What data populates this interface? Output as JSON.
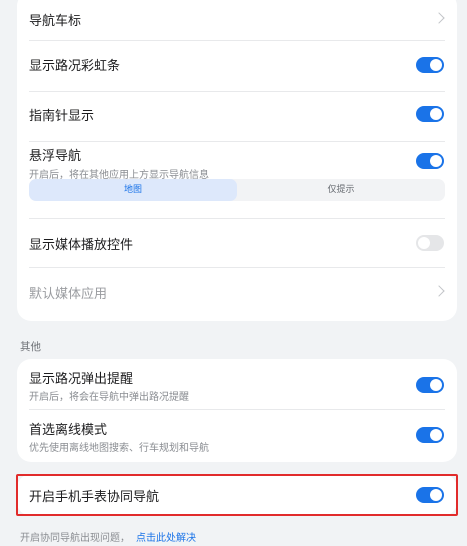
{
  "card1": {
    "items": [
      {
        "title": "导航车标"
      },
      {
        "title": "显示路况彩虹条"
      },
      {
        "title": "指南针显示"
      },
      {
        "title": "悬浮导航",
        "subtitle": "开启后，将在其他应用上方显示导航信息"
      },
      {
        "title": "显示媒体播放控件"
      },
      {
        "title": "默认媒体应用"
      }
    ],
    "float_mode": {
      "options": [
        "地图",
        "仅提示"
      ],
      "selected": "地图"
    },
    "toggles": {
      "rainbow": true,
      "compass": true,
      "floating": true,
      "media_controls": false
    }
  },
  "section_other": {
    "label": "其他"
  },
  "card2": {
    "items": [
      {
        "title": "显示路况弹出提醒",
        "subtitle": "开启后，将会在导航中弹出路况提醒"
      },
      {
        "title": "首选离线模式",
        "subtitle": "优先使用离线地图搜索、行车规划和导航"
      }
    ],
    "toggles": {
      "traffic_popup": true,
      "offline": true
    }
  },
  "card3": {
    "items": [
      {
        "title": "开启手机手表协同导航"
      }
    ],
    "toggles": {
      "watch_nav": true
    }
  },
  "footer": {
    "text": "开启协同导航出现问题，",
    "link": "点击此处解决"
  },
  "colors": {
    "accent": "#1a73e8",
    "highlight": "#e12b2b",
    "background": "#f1f3f5"
  }
}
